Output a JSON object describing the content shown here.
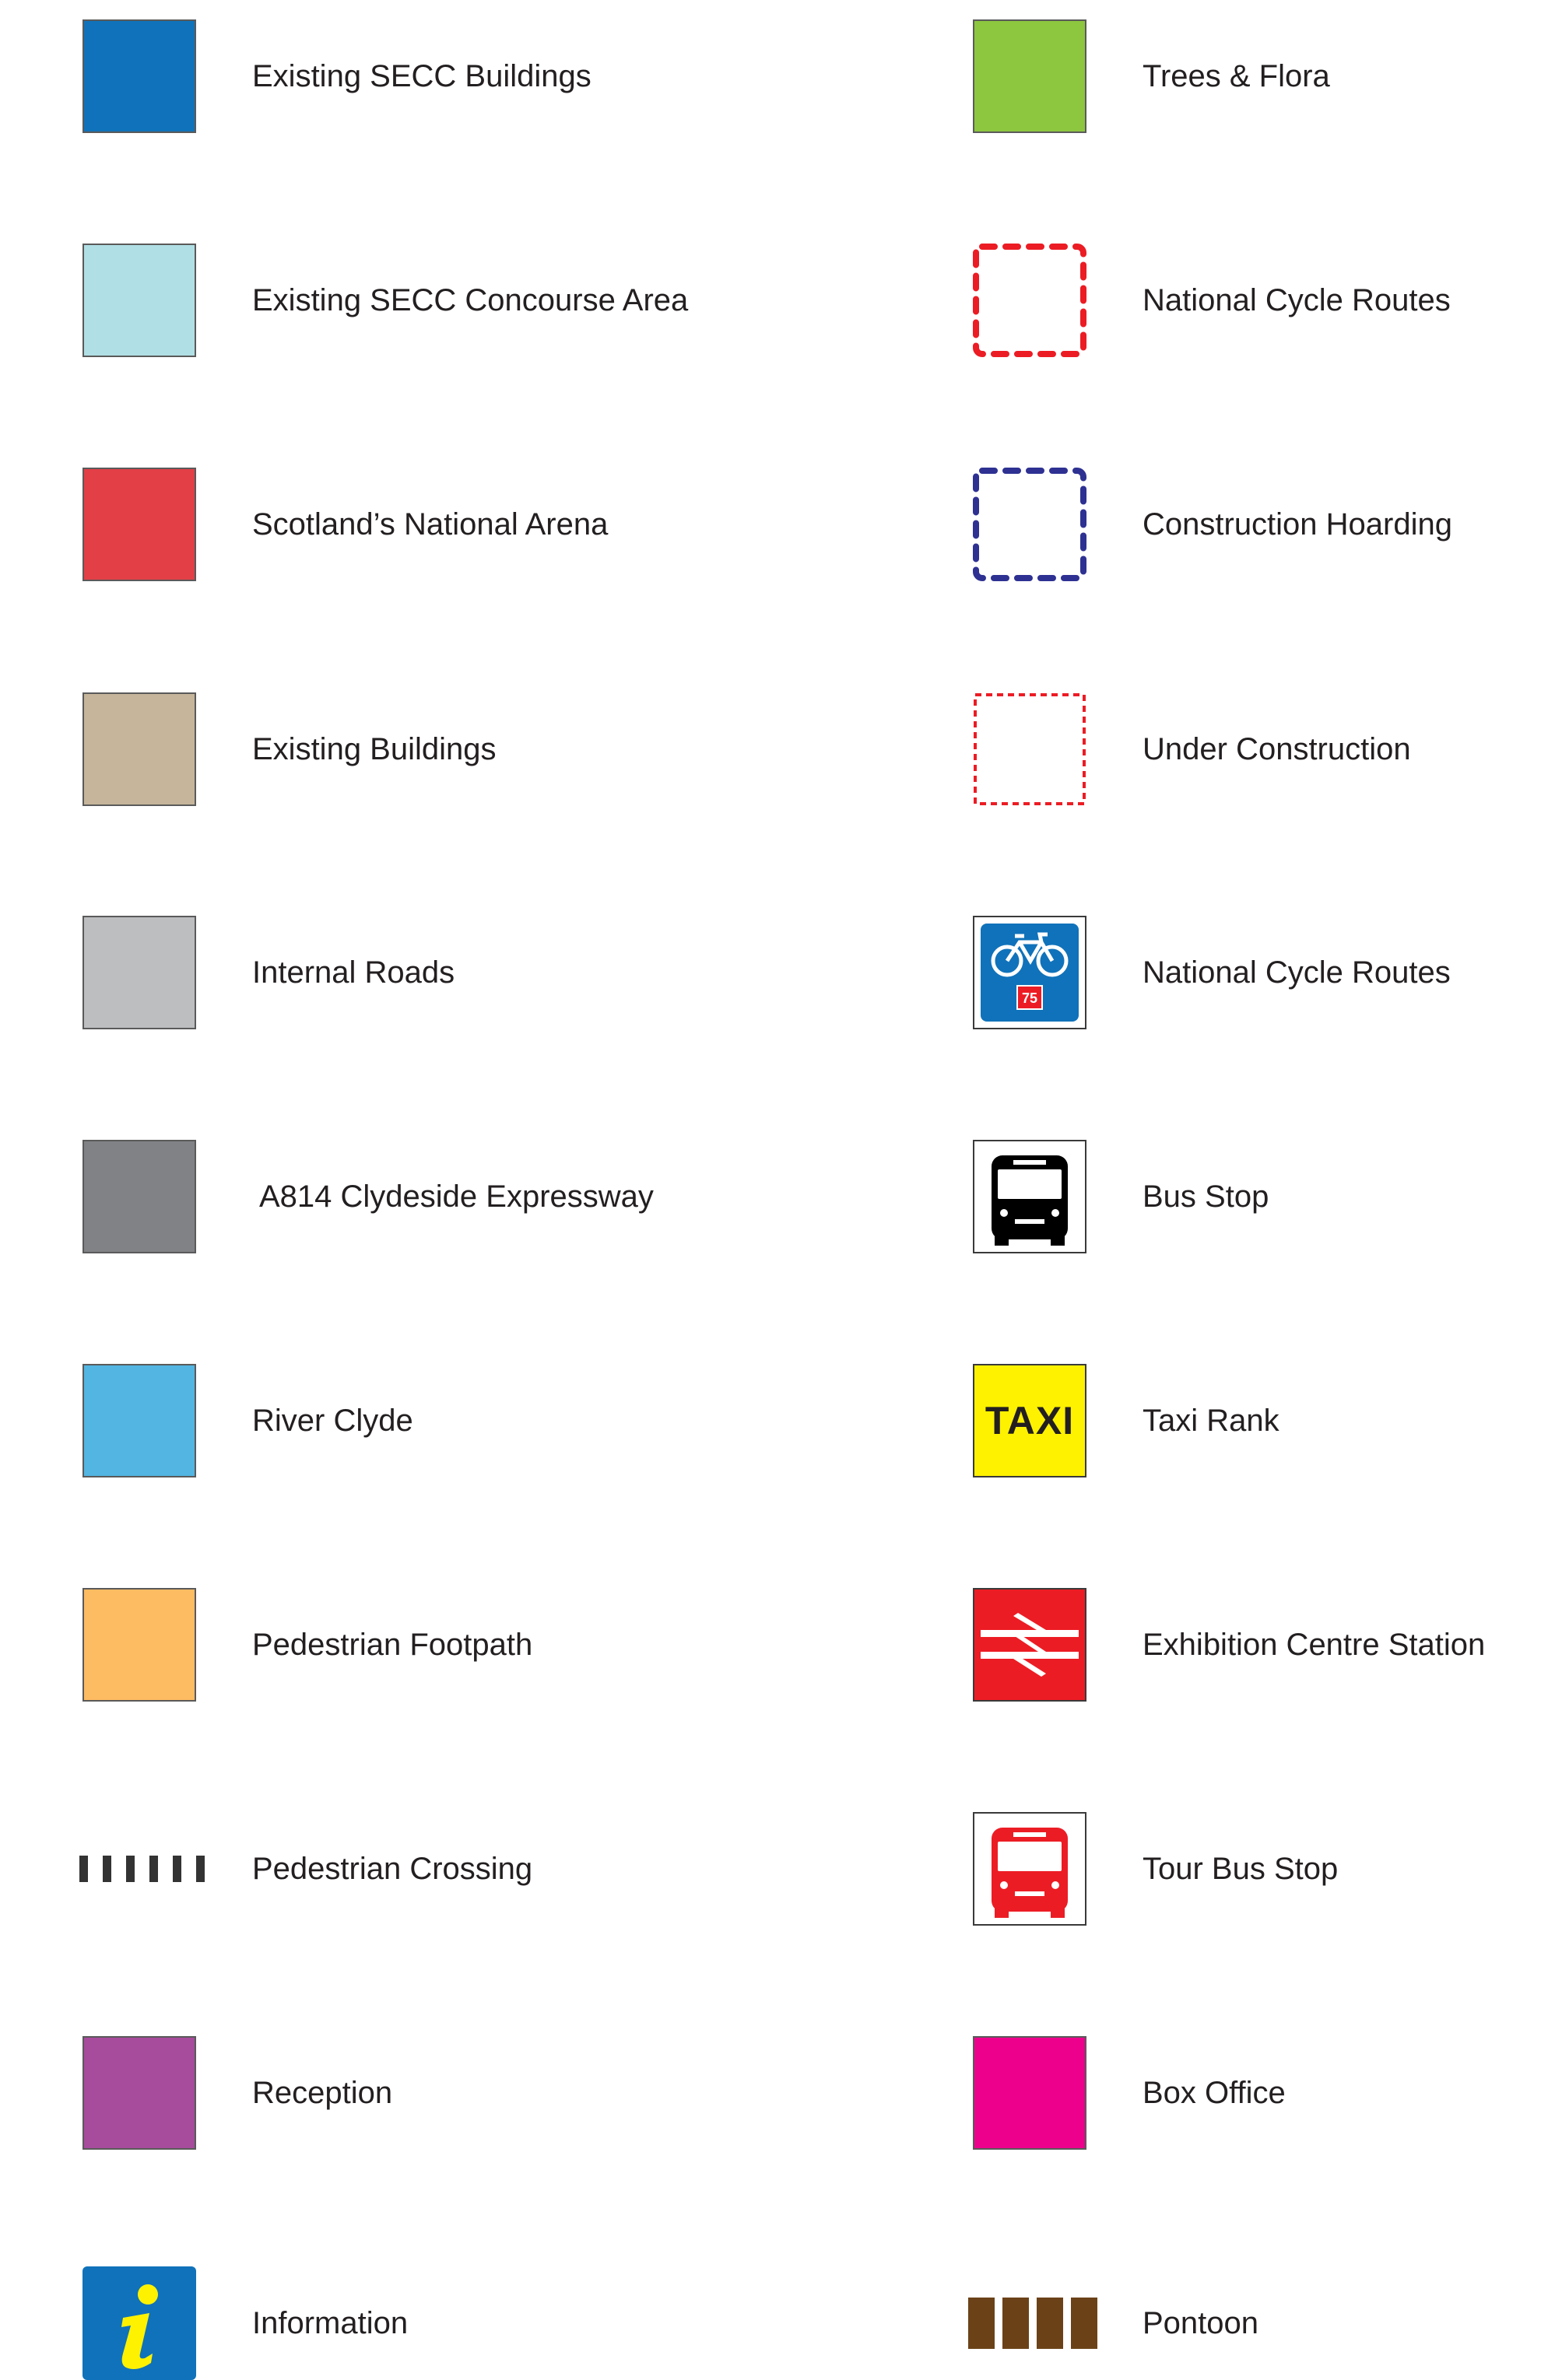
{
  "legend": {
    "left": [
      {
        "label": "Existing SECC Buildings",
        "symbol": "swatch",
        "color": "#1072ba"
      },
      {
        "label": "Existing SECC Concourse Area",
        "symbol": "swatch",
        "color": "#b0dfe5"
      },
      {
        "label": "Scotland’s National Arena",
        "symbol": "swatch",
        "color": "#e23f47"
      },
      {
        "label": "Existing Buildings",
        "symbol": "swatch",
        "color": "#c6b59b"
      },
      {
        "label": "Internal Roads",
        "symbol": "swatch",
        "color": "#bcbec0"
      },
      {
        "label": "A814 Clydeside Expressway",
        "symbol": "swatch",
        "color": "#808285"
      },
      {
        "label": "River Clyde",
        "symbol": "swatch",
        "color": "#52b5e2"
      },
      {
        "label": "Pedestrian Footpath",
        "symbol": "swatch",
        "color": "#fdbb62"
      },
      {
        "label": "Pedestrian Crossing",
        "symbol": "crossing-stripes-icon",
        "color": "#333333"
      },
      {
        "label": "Reception",
        "symbol": "swatch",
        "color": "#a74b9c"
      },
      {
        "label": "Information",
        "symbol": "information-icon",
        "color": "#1072ba"
      }
    ],
    "right": [
      {
        "label": "Trees & Flora",
        "symbol": "swatch",
        "color": "#8dc63f"
      },
      {
        "label": "National Cycle Routes",
        "symbol": "dashed-outline-icon",
        "color": "#ec1c24"
      },
      {
        "label": "Construction Hoarding",
        "symbol": "dashed-outline-icon",
        "color": "#2e3192"
      },
      {
        "label": "Under Construction",
        "symbol": "dotted-outline-icon",
        "color": "#ec1c24"
      },
      {
        "label": "National Cycle Routes",
        "symbol": "cycle-route-sign-icon",
        "color": "#1072ba",
        "route_number": "75"
      },
      {
        "label": "Bus Stop",
        "symbol": "bus-icon",
        "color": "#000000"
      },
      {
        "label": "Taxi Rank",
        "symbol": "taxi-sign-icon",
        "color": "#fff200",
        "sign_text": "TAXI"
      },
      {
        "label": "Exhibition Centre Station",
        "symbol": "rail-icon",
        "color": "#ec1c24"
      },
      {
        "label": "Tour Bus Stop",
        "symbol": "tour-bus-icon",
        "color": "#ec1c24"
      },
      {
        "label": "Box Office",
        "symbol": "swatch",
        "color": "#ec008c"
      },
      {
        "label": "Pontoon",
        "symbol": "pontoon-icon",
        "color": "#6b4218"
      }
    ]
  }
}
